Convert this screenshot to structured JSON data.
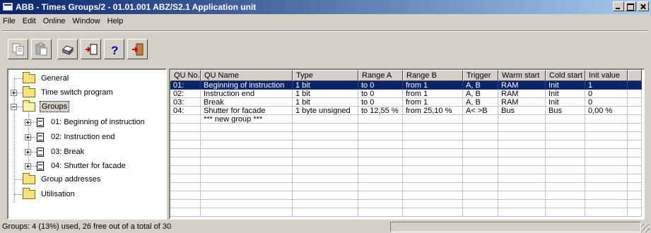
{
  "window": {
    "title": "ABB - Times Groups/2 - 01.01.001 ABZ/S2.1 Application unit"
  },
  "menu": [
    "File",
    "Edit",
    "Online",
    "Window",
    "Help"
  ],
  "toolbar": {
    "buttons": [
      "copy-icon",
      "paste-icon",
      "print-icon",
      "import-icon",
      "help-icon",
      "exit-icon"
    ]
  },
  "tree": {
    "general": "General",
    "time_switch": "Time switch program",
    "groups": "Groups",
    "group1": "01: Beginning of instruction",
    "group2": "02: Instruction end",
    "group3": "03: Break",
    "group4": "04: Shutter for facade",
    "group_addresses": "Group addresses",
    "utilisation": "Utilisation"
  },
  "grid": {
    "columns": [
      "QU No.",
      "QU Name",
      "Type",
      "Range A",
      "Range B",
      "Trigger",
      "Warm start",
      "Cold start",
      "Init value"
    ],
    "rows": [
      [
        "01:",
        "Beginning of instruction",
        "1 bit",
        "to 0",
        "from 1",
        "A, B",
        "RAM",
        "Init",
        "1"
      ],
      [
        "02:",
        "Instruction end",
        "1 bit",
        "to 0",
        "from 1",
        "A, B",
        "RAM",
        "Init",
        "0"
      ],
      [
        "03:",
        "Break",
        "1 bit",
        "to 0",
        "from 1",
        "A, B",
        "RAM",
        "Init",
        "0"
      ],
      [
        "04:",
        "Shutter for facade",
        "1 byte unsigned",
        "to 12,55 %",
        "from 25,10 %",
        "A< >B",
        "Bus",
        "Bus",
        "0,00 %"
      ],
      [
        "",
        "*** new group ***",
        "",
        "",
        "",
        "",
        "",
        "",
        ""
      ]
    ]
  },
  "status": {
    "text": "Groups: 4 (13%) used, 26 free out of a total of 30"
  },
  "colors": {
    "selection": "#0a246a",
    "face": "#d4d0c8",
    "folder": "#f7e27a"
  }
}
